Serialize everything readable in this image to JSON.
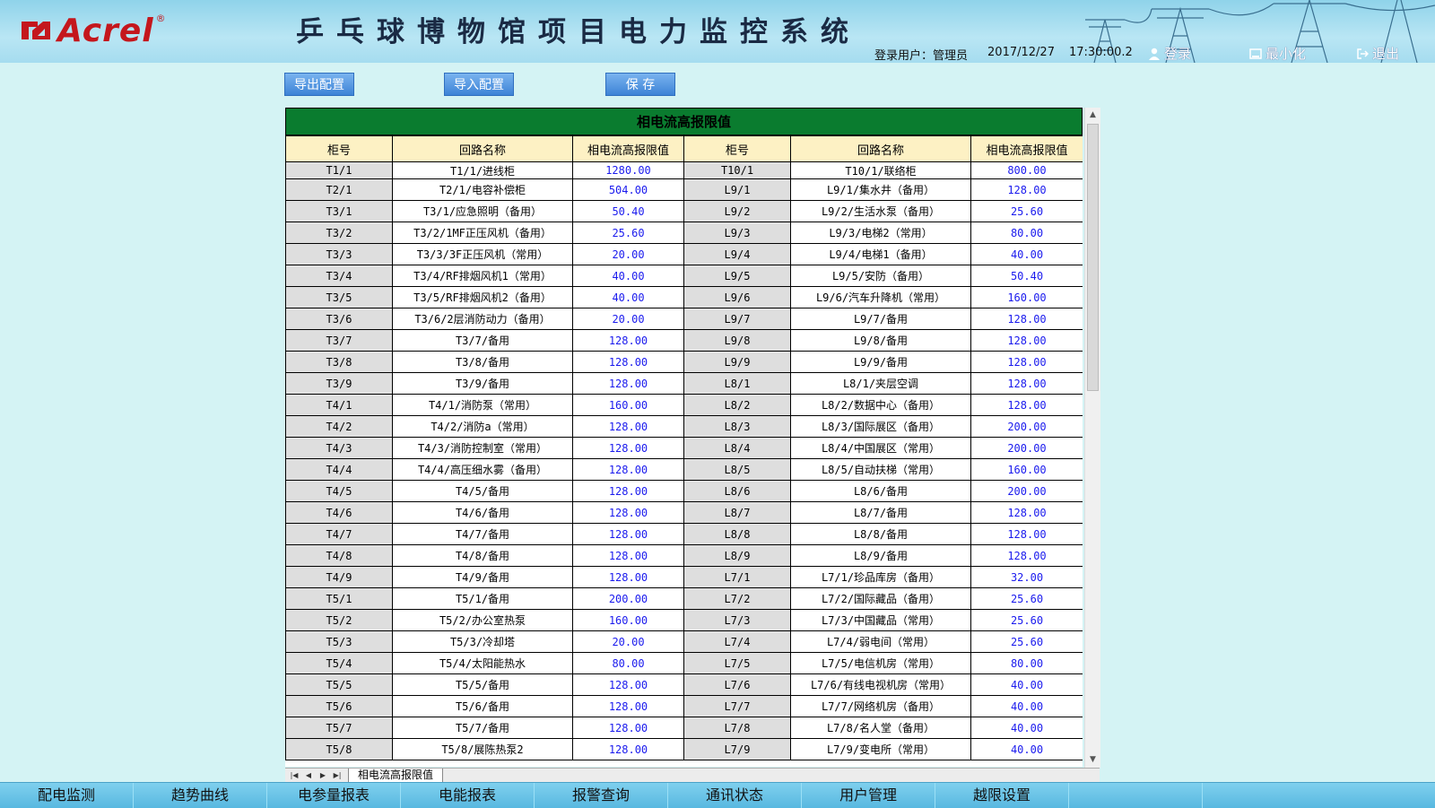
{
  "header": {
    "brand": "Acrel",
    "brand_reg": "®",
    "title": "乒乓球博物馆项目电力监控系统",
    "login_user_label": "登录用户：",
    "login_user": "管理员",
    "date": "2017/12/27",
    "time": "17:30:00.2",
    "login_btn": "登录",
    "minimize_btn": "最小化",
    "exit_btn": "退出"
  },
  "toolbar": {
    "export_label": "导出配置",
    "import_label": "导入配置",
    "save_label": "保 存"
  },
  "table": {
    "caption": "相电流高报限值",
    "headers": [
      "柜号",
      "回路名称",
      "相电流高报限值",
      "柜号",
      "回路名称",
      "相电流高报限值"
    ],
    "rows": [
      [
        "T1/1",
        "T1/1/进线柜",
        "1280.00",
        "T10/1",
        "T10/1/联络柜",
        "800.00"
      ],
      [
        "T2/1",
        "T2/1/电容补偿柜",
        "504.00",
        "L9/1",
        "L9/1/集水井（备用）",
        "128.00"
      ],
      [
        "T3/1",
        "T3/1/应急照明（备用）",
        "50.40",
        "L9/2",
        "L9/2/生活水泵（备用）",
        "25.60"
      ],
      [
        "T3/2",
        "T3/2/1MF正压风机（备用）",
        "25.60",
        "L9/3",
        "L9/3/电梯2（常用）",
        "80.00"
      ],
      [
        "T3/3",
        "T3/3/3F正压风机（常用）",
        "20.00",
        "L9/4",
        "L9/4/电梯1（备用）",
        "40.00"
      ],
      [
        "T3/4",
        "T3/4/RF排烟风机1（常用）",
        "40.00",
        "L9/5",
        "L9/5/安防（备用）",
        "50.40"
      ],
      [
        "T3/5",
        "T3/5/RF排烟风机2（备用）",
        "40.00",
        "L9/6",
        "L9/6/汽车升降机（常用）",
        "160.00"
      ],
      [
        "T3/6",
        "T3/6/2层消防动力（备用）",
        "20.00",
        "L9/7",
        "L9/7/备用",
        "128.00"
      ],
      [
        "T3/7",
        "T3/7/备用",
        "128.00",
        "L9/8",
        "L9/8/备用",
        "128.00"
      ],
      [
        "T3/8",
        "T3/8/备用",
        "128.00",
        "L9/9",
        "L9/9/备用",
        "128.00"
      ],
      [
        "T3/9",
        "T3/9/备用",
        "128.00",
        "L8/1",
        "L8/1/夹层空调",
        "128.00"
      ],
      [
        "T4/1",
        "T4/1/消防泵（常用）",
        "160.00",
        "L8/2",
        "L8/2/数据中心（备用）",
        "128.00"
      ],
      [
        "T4/2",
        "T4/2/消防a（常用）",
        "128.00",
        "L8/3",
        "L8/3/国际展区（备用）",
        "200.00"
      ],
      [
        "T4/3",
        "T4/3/消防控制室（常用）",
        "128.00",
        "L8/4",
        "L8/4/中国展区（常用）",
        "200.00"
      ],
      [
        "T4/4",
        "T4/4/高压细水雾（备用）",
        "128.00",
        "L8/5",
        "L8/5/自动扶梯（常用）",
        "160.00"
      ],
      [
        "T4/5",
        "T4/5/备用",
        "128.00",
        "L8/6",
        "L8/6/备用",
        "200.00"
      ],
      [
        "T4/6",
        "T4/6/备用",
        "128.00",
        "L8/7",
        "L8/7/备用",
        "128.00"
      ],
      [
        "T4/7",
        "T4/7/备用",
        "128.00",
        "L8/8",
        "L8/8/备用",
        "128.00"
      ],
      [
        "T4/8",
        "T4/8/备用",
        "128.00",
        "L8/9",
        "L8/9/备用",
        "128.00"
      ],
      [
        "T4/9",
        "T4/9/备用",
        "128.00",
        "L7/1",
        "L7/1/珍品库房（备用）",
        "32.00"
      ],
      [
        "T5/1",
        "T5/1/备用",
        "200.00",
        "L7/2",
        "L7/2/国际藏品（备用）",
        "25.60"
      ],
      [
        "T5/2",
        "T5/2/办公室热泵",
        "160.00",
        "L7/3",
        "L7/3/中国藏品（常用）",
        "25.60"
      ],
      [
        "T5/3",
        "T5/3/冷却塔",
        "20.00",
        "L7/4",
        "L7/4/弱电间（常用）",
        "25.60"
      ],
      [
        "T5/4",
        "T5/4/太阳能热水",
        "80.00",
        "L7/5",
        "L7/5/电信机房（常用）",
        "80.00"
      ],
      [
        "T5/5",
        "T5/5/备用",
        "128.00",
        "L7/6",
        "L7/6/有线电视机房（常用）",
        "40.00"
      ],
      [
        "T5/6",
        "T5/6/备用",
        "128.00",
        "L7/7",
        "L7/7/网络机房（备用）",
        "40.00"
      ],
      [
        "T5/7",
        "T5/7/备用",
        "128.00",
        "L7/8",
        "L7/8/名人堂（备用）",
        "40.00"
      ],
      [
        "T5/8",
        "T5/8/展陈热泵2",
        "128.00",
        "L7/9",
        "L7/9/变电所（常用）",
        "40.00"
      ]
    ]
  },
  "sheet_tab": "相电流高报限值",
  "bottom_nav": [
    "配电监测",
    "趋势曲线",
    "电参量报表",
    "电能报表",
    "报警查询",
    "通讯状态",
    "用户管理",
    "越限设置",
    "",
    ""
  ],
  "colors": {
    "header_green": "#0a7c2f",
    "value_blue": "#1a1aee",
    "brand_red": "#c4171d"
  }
}
